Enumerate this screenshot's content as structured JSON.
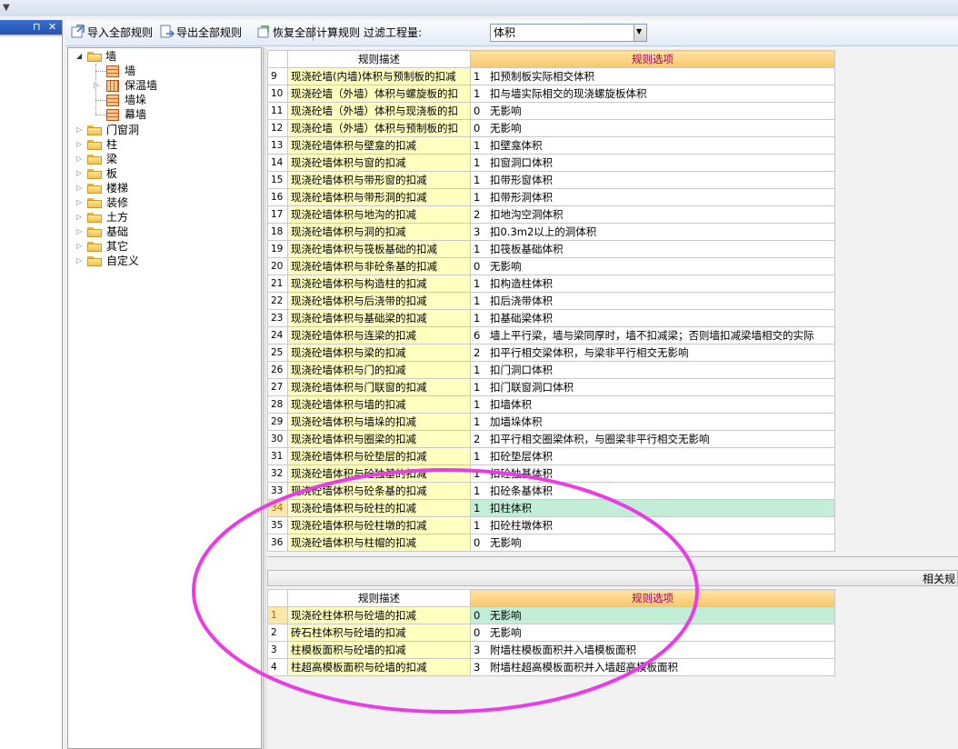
{
  "toolbar": {
    "import_label": "导入全部规则",
    "export_label": "导出全部规则",
    "restore_label": "恢复全部计算规则",
    "filter_label": "过滤工程量:",
    "filter_value": "体积"
  },
  "tree": {
    "root": "墙",
    "children": [
      "墙",
      "保温墙",
      "墙垛",
      "幕墙"
    ],
    "categories": [
      "门窗洞",
      "柱",
      "梁",
      "板",
      "楼梯",
      "装修",
      "土方",
      "基础",
      "其它",
      "自定义"
    ]
  },
  "main_table": {
    "header_desc": "规则描述",
    "header_option": "规则选项",
    "rows": [
      {
        "no": "9",
        "desc": "现浇砼墙(内墙)体积与预制板的扣减",
        "code": "1",
        "option": "扣预制板实际相交体积"
      },
      {
        "no": "10",
        "desc": "现浇砼墙（外墙）体积与螺旋板的扣",
        "code": "1",
        "option": "扣与墙实际相交的现浇螺旋板体积"
      },
      {
        "no": "11",
        "desc": "现浇砼墙（外墙）体积与现浇板的扣",
        "code": "0",
        "option": "无影响"
      },
      {
        "no": "12",
        "desc": "现浇砼墙（外墙）体积与预制板的扣",
        "code": "0",
        "option": "无影响"
      },
      {
        "no": "13",
        "desc": "现浇砼墙体积与壁龛的扣减",
        "code": "1",
        "option": "扣壁龛体积"
      },
      {
        "no": "14",
        "desc": "现浇砼墙体积与窗的扣减",
        "code": "1",
        "option": "扣窗洞口体积"
      },
      {
        "no": "15",
        "desc": "现浇砼墙体积与带形窗的扣减",
        "code": "1",
        "option": "扣带形窗体积"
      },
      {
        "no": "16",
        "desc": "现浇砼墙体积与带形洞的扣减",
        "code": "1",
        "option": "扣带形洞体积"
      },
      {
        "no": "17",
        "desc": "现浇砼墙体积与地沟的扣减",
        "code": "2",
        "option": "扣地沟空洞体积"
      },
      {
        "no": "18",
        "desc": "现浇砼墙体积与洞的扣减",
        "code": "3",
        "option": "扣0.3m2以上的洞体积"
      },
      {
        "no": "19",
        "desc": "现浇砼墙体积与筏板基础的扣减",
        "code": "1",
        "option": "扣筏板基础体积"
      },
      {
        "no": "20",
        "desc": "现浇砼墙体积与非砼条基的扣减",
        "code": "0",
        "option": "无影响"
      },
      {
        "no": "21",
        "desc": "现浇砼墙体积与构造柱的扣减",
        "code": "1",
        "option": "扣构造柱体积"
      },
      {
        "no": "22",
        "desc": "现浇砼墙体积与后浇带的扣减",
        "code": "1",
        "option": "扣后浇带体积"
      },
      {
        "no": "23",
        "desc": "现浇砼墙体积与基础梁的扣减",
        "code": "1",
        "option": "扣基础梁体积"
      },
      {
        "no": "24",
        "desc": "现浇砼墙体积与连梁的扣减",
        "code": "6",
        "option": "墙上平行梁，墙与梁同厚时，墙不扣减梁；否则墙扣减梁墙相交的实际"
      },
      {
        "no": "25",
        "desc": "现浇砼墙体积与梁的扣减",
        "code": "2",
        "option": "扣平行相交梁体积，与梁非平行相交无影响"
      },
      {
        "no": "26",
        "desc": "现浇砼墙体积与门的扣减",
        "code": "1",
        "option": "扣门洞口体积"
      },
      {
        "no": "27",
        "desc": "现浇砼墙体积与门联窗的扣减",
        "code": "1",
        "option": "扣门联窗洞口体积"
      },
      {
        "no": "28",
        "desc": "现浇砼墙体积与墙的扣减",
        "code": "1",
        "option": "扣墙体积"
      },
      {
        "no": "29",
        "desc": "现浇砼墙体积与墙垛的扣减",
        "code": "1",
        "option": "加墙垛体积"
      },
      {
        "no": "30",
        "desc": "现浇砼墙体积与圈梁的扣减",
        "code": "2",
        "option": "扣平行相交圈梁体积，与圈梁非平行相交无影响"
      },
      {
        "no": "31",
        "desc": "现浇砼墙体积与砼垫层的扣减",
        "code": "1",
        "option": "扣砼垫层体积"
      },
      {
        "no": "32",
        "desc": "现浇砼墙体积与砼独基的扣减",
        "code": "1",
        "option": "扣砼独基体积"
      },
      {
        "no": "33",
        "desc": "现浇砼墙体积与砼条基的扣减",
        "code": "1",
        "option": "扣砼条基体积"
      },
      {
        "no": "34",
        "desc": "现浇砼墙体积与砼柱的扣减",
        "code": "1",
        "option": "扣柱体积",
        "selected": true
      },
      {
        "no": "35",
        "desc": "现浇砼墙体积与砼柱墩的扣减",
        "code": "1",
        "option": "扣砼柱墩体积"
      },
      {
        "no": "36",
        "desc": "现浇砼墙体积与柱帽的扣减",
        "code": "0",
        "option": "无影响"
      }
    ]
  },
  "related": {
    "label": "相关规",
    "header_desc": "规则描述",
    "header_option": "规则选项",
    "rows": [
      {
        "no": "1",
        "desc": "现浇砼柱体积与砼墙的扣减",
        "code": "0",
        "option": "无影响",
        "selected": true
      },
      {
        "no": "2",
        "desc": "砖石柱体积与砼墙的扣减",
        "code": "0",
        "option": "无影响"
      },
      {
        "no": "3",
        "desc": "柱模板面积与砼墙的扣减",
        "code": "3",
        "option": "附墙柱模板面积并入墙模板面积"
      },
      {
        "no": "4",
        "desc": "柱超高模板面积与砼墙的扣减",
        "code": "3",
        "option": "附墙柱超高模板面积并入墙超高模板面积"
      }
    ]
  },
  "colors": {
    "annotation": "#ea3ce6",
    "selected_row": "#c2eed8",
    "desc_bg": "#ffffc0"
  }
}
